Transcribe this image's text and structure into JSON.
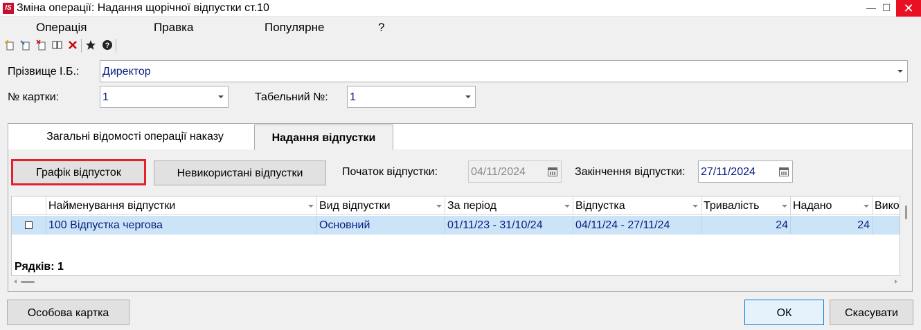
{
  "window": {
    "title": "Зміна операції: Надання щорічної відпустки ст.10",
    "logo_text": "IS",
    "minimize_glyph": "—",
    "maximize_glyph": "☐",
    "close_glyph": "✕"
  },
  "menu": [
    "Операція",
    "Правка",
    "Популярне",
    "?"
  ],
  "toolbar": {
    "icons": [
      "new-doc-icon",
      "edit-doc-icon",
      "delete-doc-icon",
      "book-icon",
      "delete-x-icon",
      "star-icon",
      "help-icon"
    ]
  },
  "form": {
    "surname_label": "Прізвище І.Б.:",
    "surname_value": "Директор",
    "card_label": "№ картки:",
    "card_value": "1",
    "tab_number_label": "Табельний №:",
    "tab_number_value": "1"
  },
  "tabs": [
    {
      "label": "Загальні відомості операції наказу",
      "active": false
    },
    {
      "label": "Надання відпустки",
      "active": true
    }
  ],
  "vacation": {
    "schedule_button": "Графік відпусток",
    "unused_button": "Невикористані відпустки",
    "start_label": "Початок відпустки:",
    "start_value": "04/11/2024",
    "end_label": "Закінчення відпустки:",
    "end_value": "27/11/2024"
  },
  "grid": {
    "columns": [
      "Найменування відпустки",
      "Вид відпустки",
      "За період",
      "Відпустка",
      "Тривалість",
      "Надано",
      "Вико"
    ],
    "rows": [
      {
        "name": "100 Відпустка чергова",
        "type": "Основний",
        "period": "01/11/23 - 31/10/24",
        "vacation": "04/11/24 - 27/11/24",
        "duration": "24",
        "granted": "24",
        "used": ""
      }
    ],
    "rows_count": "Рядків: 1"
  },
  "footer": {
    "personal_card_button": "Особова картка",
    "ok_button": "ОК",
    "cancel_button": "Скасувати"
  },
  "colors": {
    "highlight_border": "#e4202a",
    "selected_row": "#cce4f7",
    "field_text": "#0a1e82"
  }
}
